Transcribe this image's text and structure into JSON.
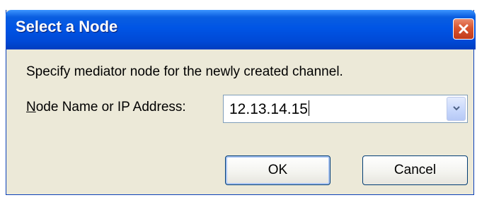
{
  "dialog": {
    "title": "Select a Node",
    "message": "Specify mediator node for the newly created channel.",
    "field_label_mnemonic": "N",
    "field_label_rest": "ode Name or IP Address:",
    "field_value": "12.13.14.15",
    "ok_label": "OK",
    "cancel_label": "Cancel"
  },
  "icons": {
    "close": "close-icon",
    "dropdown": "chevron-down-icon"
  }
}
